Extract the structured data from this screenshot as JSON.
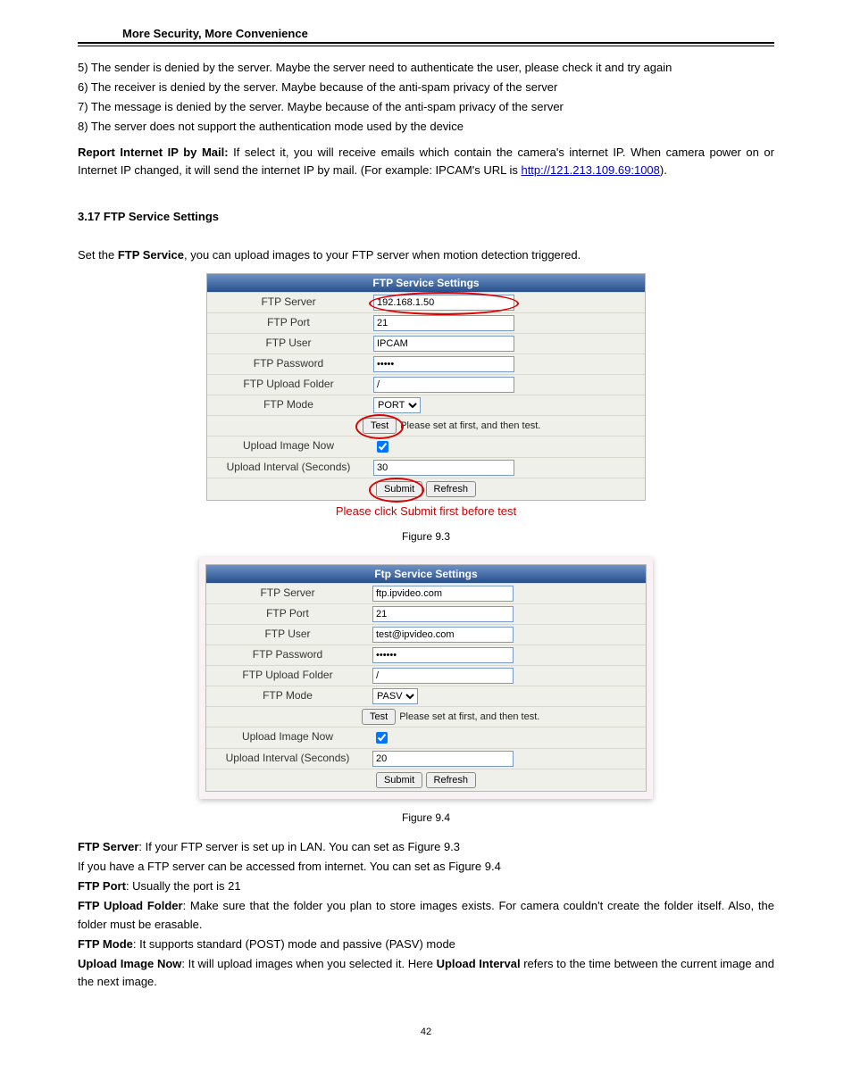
{
  "header": {
    "slogan": "More Security, More Convenience"
  },
  "intro": {
    "p5": "5) The sender is denied by the server. Maybe the server need to authenticate the user, please check it and try again",
    "p6": "6) The receiver is denied by the server. Maybe because of the anti-spam privacy of the server",
    "p7": "7) The message is denied by the server. Maybe because of the anti-spam privacy of the server",
    "p8": "8) The server does not support the authentication mode used by the device",
    "report_label": "Report Internet IP by Mail:",
    "report_text_a": " If select it, you will receive emails which contain the camera's internet IP. When camera power on or Internet IP changed, it will send the internet IP by mail. (For example: IPCAM's URL is ",
    "report_link": "http://121.213.109.69:1008",
    "report_text_b": ")."
  },
  "section": {
    "title": "3.17 FTP Service Settings",
    "intro_a": "Set the ",
    "intro_b": "FTP Service",
    "intro_c": ", you can upload images to your FTP server when motion detection triggered."
  },
  "panel1": {
    "title": "FTP Service Settings",
    "labels": {
      "server": "FTP Server",
      "port": "FTP Port",
      "user": "FTP User",
      "pwd": "FTP Password",
      "folder": "FTP Upload Folder",
      "mode": "FTP Mode",
      "test": "Test",
      "test_note": "Please set at first, and then test.",
      "upload_now": "Upload Image Now",
      "interval": "Upload Interval (Seconds)",
      "submit": "Submit",
      "refresh": "Refresh"
    },
    "values": {
      "server": "192.168.1.50",
      "port": "21",
      "user": "IPCAM",
      "pwd": "•••••",
      "folder": "/",
      "mode": "PORT",
      "interval": "30"
    },
    "red_note": "Please click Submit first before test"
  },
  "fig1": "Figure 9.3",
  "panel2": {
    "title": "Ftp Service Settings",
    "labels": {
      "server": "FTP Server",
      "port": "FTP Port",
      "user": "FTP User",
      "pwd": "FTP Password",
      "folder": "FTP Upload Folder",
      "mode": "FTP Mode",
      "test": "Test",
      "test_note": "Please set at first, and then test.",
      "upload_now": "Upload Image Now",
      "interval": "Upload Interval (Seconds)",
      "submit": "Submit",
      "refresh": "Refresh"
    },
    "values": {
      "server": "ftp.ipvideo.com",
      "port": "21",
      "user": "test@ipvideo.com",
      "pwd": "••••••",
      "folder": "/",
      "mode": "PASV",
      "interval": "20"
    }
  },
  "fig2": "Figure 9.4",
  "desc": {
    "server_l": "FTP Server",
    "server_t": ": If your FTP server is set up in LAN. You can set as Figure 9.3",
    "server2": "If you have a FTP server can be accessed from internet. You can set as Figure 9.4",
    "port_l": "FTP Port",
    "port_t": ": Usually the port is 21",
    "folder_l": "FTP Upload Folder",
    "folder_t": ": Make sure that the folder you plan to store images exists. For camera couldn't create the folder itself. Also, the folder must be erasable.",
    "mode_l": "FTP Mode",
    "mode_t": ": It supports standard (POST) mode and passive (PASV) mode",
    "upload_l": "Upload Image Now",
    "upload_t_a": ": It will upload images when you selected it. Here ",
    "interval_l": "Upload Interval",
    "upload_t_b": " refers to the time between the current image and the next image."
  },
  "page_number": "42"
}
